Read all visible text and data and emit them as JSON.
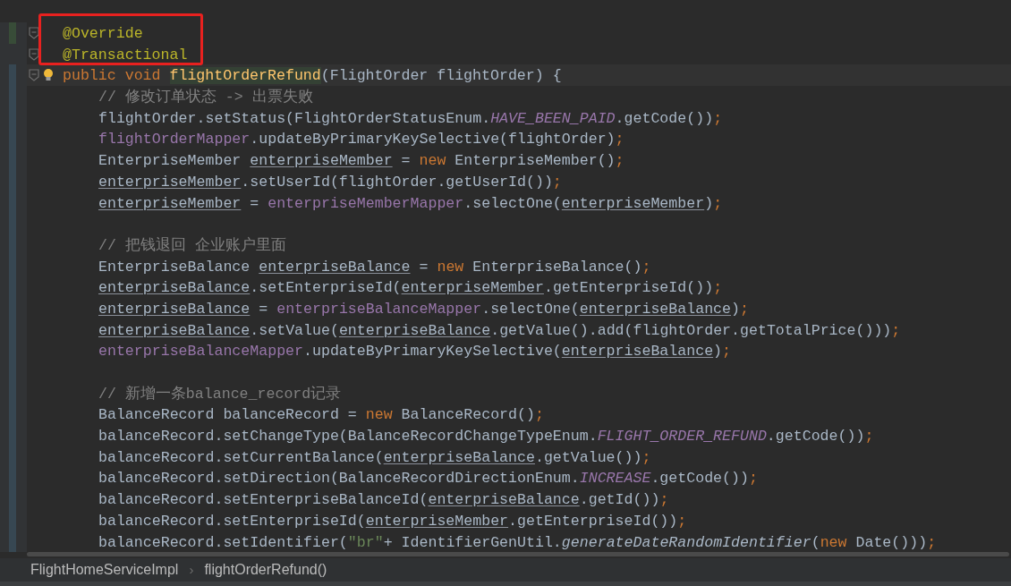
{
  "editor": {
    "lines": [
      {
        "kind": "decl",
        "current": false,
        "added": true,
        "modified": false,
        "tokens": [
          {
            "kind": "annotation",
            "text": "@Override"
          }
        ]
      },
      {
        "kind": "decl",
        "current": false,
        "added": false,
        "modified": false,
        "tokens": [
          {
            "kind": "annotation",
            "text": "@Transactional"
          }
        ]
      },
      {
        "kind": "decl",
        "current": true,
        "added": false,
        "modified": true,
        "tokens": [
          {
            "kind": "keyword",
            "text": "public void "
          },
          {
            "kind": "method",
            "text": "flightOrderRefund"
          },
          {
            "kind": "plain",
            "text": "(FlightOrder flightOrder) {"
          }
        ]
      },
      {
        "kind": "body",
        "current": false,
        "added": false,
        "modified": true,
        "tokens": [
          {
            "kind": "comment",
            "text": "// 修改订单状态 -> 出票失败"
          }
        ]
      },
      {
        "kind": "body",
        "current": false,
        "added": false,
        "modified": true,
        "tokens": [
          {
            "kind": "plain",
            "text": "flightOrder.setStatus(FlightOrderStatusEnum."
          },
          {
            "kind": "constant",
            "text": "HAVE_BEEN_PAID"
          },
          {
            "kind": "plain",
            "text": ".getCode())"
          },
          {
            "kind": "punct",
            "text": ";"
          }
        ]
      },
      {
        "kind": "body",
        "current": false,
        "added": false,
        "modified": true,
        "tokens": [
          {
            "kind": "field",
            "text": "flightOrderMapper"
          },
          {
            "kind": "plain",
            "text": ".updateByPrimaryKeySelective(flightOrder)"
          },
          {
            "kind": "punct",
            "text": ";"
          }
        ]
      },
      {
        "kind": "body",
        "current": false,
        "added": false,
        "modified": true,
        "tokens": [
          {
            "kind": "plain",
            "text": "EnterpriseMember "
          },
          {
            "kind": "local",
            "text": "enterpriseMember"
          },
          {
            "kind": "plain",
            "text": " = "
          },
          {
            "kind": "keyword",
            "text": "new"
          },
          {
            "kind": "plain",
            "text": " EnterpriseMember()"
          },
          {
            "kind": "punct",
            "text": ";"
          }
        ]
      },
      {
        "kind": "body",
        "current": false,
        "added": false,
        "modified": true,
        "tokens": [
          {
            "kind": "local",
            "text": "enterpriseMember"
          },
          {
            "kind": "plain",
            "text": ".setUserId(flightOrder.getUserId())"
          },
          {
            "kind": "punct",
            "text": ";"
          }
        ]
      },
      {
        "kind": "body",
        "current": false,
        "added": false,
        "modified": true,
        "tokens": [
          {
            "kind": "local",
            "text": "enterpriseMember"
          },
          {
            "kind": "plain",
            "text": " = "
          },
          {
            "kind": "field",
            "text": "enterpriseMemberMapper"
          },
          {
            "kind": "plain",
            "text": ".selectOne("
          },
          {
            "kind": "local",
            "text": "enterpriseMember"
          },
          {
            "kind": "plain",
            "text": ")"
          },
          {
            "kind": "punct",
            "text": ";"
          }
        ]
      },
      {
        "kind": "blank",
        "current": false,
        "added": false,
        "modified": true
      },
      {
        "kind": "body",
        "current": false,
        "added": false,
        "modified": true,
        "tokens": [
          {
            "kind": "comment",
            "text": "// 把钱退回 企业账户里面"
          }
        ]
      },
      {
        "kind": "body",
        "current": false,
        "added": false,
        "modified": true,
        "tokens": [
          {
            "kind": "plain",
            "text": "EnterpriseBalance "
          },
          {
            "kind": "local",
            "text": "enterpriseBalance"
          },
          {
            "kind": "plain",
            "text": " = "
          },
          {
            "kind": "keyword",
            "text": "new"
          },
          {
            "kind": "plain",
            "text": " EnterpriseBalance()"
          },
          {
            "kind": "punct",
            "text": ";"
          }
        ]
      },
      {
        "kind": "body",
        "current": false,
        "added": false,
        "modified": true,
        "tokens": [
          {
            "kind": "local",
            "text": "enterpriseBalance"
          },
          {
            "kind": "plain",
            "text": ".setEnterpriseId("
          },
          {
            "kind": "local",
            "text": "enterpriseMember"
          },
          {
            "kind": "plain",
            "text": ".getEnterpriseId())"
          },
          {
            "kind": "punct",
            "text": ";"
          }
        ]
      },
      {
        "kind": "body",
        "current": false,
        "added": false,
        "modified": true,
        "tokens": [
          {
            "kind": "local",
            "text": "enterpriseBalance"
          },
          {
            "kind": "plain",
            "text": " = "
          },
          {
            "kind": "field",
            "text": "enterpriseBalanceMapper"
          },
          {
            "kind": "plain",
            "text": ".selectOne("
          },
          {
            "kind": "local",
            "text": "enterpriseBalance"
          },
          {
            "kind": "plain",
            "text": ")"
          },
          {
            "kind": "punct",
            "text": ";"
          }
        ]
      },
      {
        "kind": "body",
        "current": false,
        "added": false,
        "modified": true,
        "tokens": [
          {
            "kind": "local",
            "text": "enterpriseBalance"
          },
          {
            "kind": "plain",
            "text": ".setValue("
          },
          {
            "kind": "local",
            "text": "enterpriseBalance"
          },
          {
            "kind": "plain",
            "text": ".getValue().add(flightOrder.getTotalPrice()))"
          },
          {
            "kind": "punct",
            "text": ";"
          }
        ]
      },
      {
        "kind": "body",
        "current": false,
        "added": false,
        "modified": true,
        "tokens": [
          {
            "kind": "field",
            "text": "enterpriseBalanceMapper"
          },
          {
            "kind": "plain",
            "text": ".updateByPrimaryKeySelective("
          },
          {
            "kind": "local",
            "text": "enterpriseBalance"
          },
          {
            "kind": "plain",
            "text": ")"
          },
          {
            "kind": "punct",
            "text": ";"
          }
        ]
      },
      {
        "kind": "blank",
        "current": false,
        "added": false,
        "modified": true
      },
      {
        "kind": "body",
        "current": false,
        "added": false,
        "modified": true,
        "tokens": [
          {
            "kind": "comment",
            "text": "// 新增一条balance_record记录"
          }
        ]
      },
      {
        "kind": "body",
        "current": false,
        "added": false,
        "modified": true,
        "tokens": [
          {
            "kind": "plain",
            "text": "BalanceRecord balanceRecord = "
          },
          {
            "kind": "keyword",
            "text": "new"
          },
          {
            "kind": "plain",
            "text": " BalanceRecord()"
          },
          {
            "kind": "punct",
            "text": ";"
          }
        ]
      },
      {
        "kind": "body",
        "current": false,
        "added": false,
        "modified": true,
        "tokens": [
          {
            "kind": "plain",
            "text": "balanceRecord.setChangeType(BalanceRecordChangeTypeEnum."
          },
          {
            "kind": "constant",
            "text": "FLIGHT_ORDER_REFUND"
          },
          {
            "kind": "plain",
            "text": ".getCode())"
          },
          {
            "kind": "punct",
            "text": ";"
          }
        ]
      },
      {
        "kind": "body",
        "current": false,
        "added": false,
        "modified": true,
        "tokens": [
          {
            "kind": "plain",
            "text": "balanceRecord.setCurrentBalance("
          },
          {
            "kind": "local",
            "text": "enterpriseBalance"
          },
          {
            "kind": "plain",
            "text": ".getValue())"
          },
          {
            "kind": "punct",
            "text": ";"
          }
        ]
      },
      {
        "kind": "body",
        "current": false,
        "added": false,
        "modified": true,
        "tokens": [
          {
            "kind": "plain",
            "text": "balanceRecord.setDirection(BalanceRecordDirectionEnum."
          },
          {
            "kind": "constant",
            "text": "INCREASE"
          },
          {
            "kind": "plain",
            "text": ".getCode())"
          },
          {
            "kind": "punct",
            "text": ";"
          }
        ]
      },
      {
        "kind": "body",
        "current": false,
        "added": false,
        "modified": true,
        "tokens": [
          {
            "kind": "plain",
            "text": "balanceRecord.setEnterpriseBalanceId("
          },
          {
            "kind": "local",
            "text": "enterpriseBalance"
          },
          {
            "kind": "plain",
            "text": ".getId())"
          },
          {
            "kind": "punct",
            "text": ";"
          }
        ]
      },
      {
        "kind": "body",
        "current": false,
        "added": false,
        "modified": true,
        "tokens": [
          {
            "kind": "plain",
            "text": "balanceRecord.setEnterpriseId("
          },
          {
            "kind": "local",
            "text": "enterpriseMember"
          },
          {
            "kind": "plain",
            "text": ".getEnterpriseId())"
          },
          {
            "kind": "punct",
            "text": ";"
          }
        ]
      },
      {
        "kind": "body",
        "current": false,
        "added": false,
        "modified": true,
        "tokens": [
          {
            "kind": "plain",
            "text": "balanceRecord.setIdentifier("
          },
          {
            "kind": "string",
            "text": "\"br\""
          },
          {
            "kind": "plain",
            "text": "+ IdentifierGenUtil."
          },
          {
            "kind": "static_call",
            "text": "generateDateRandomIdentifier"
          },
          {
            "kind": "plain",
            "text": "("
          },
          {
            "kind": "keyword",
            "text": "new"
          },
          {
            "kind": "plain",
            "text": " Date()))"
          },
          {
            "kind": "punct",
            "text": ";"
          }
        ]
      }
    ]
  },
  "breadcrumb": [
    {
      "kind": "item",
      "text": "FlightHomeServiceImpl"
    },
    {
      "kind": "separator",
      "text": "›"
    },
    {
      "kind": "item",
      "text": "flightOrderRefund()"
    }
  ]
}
